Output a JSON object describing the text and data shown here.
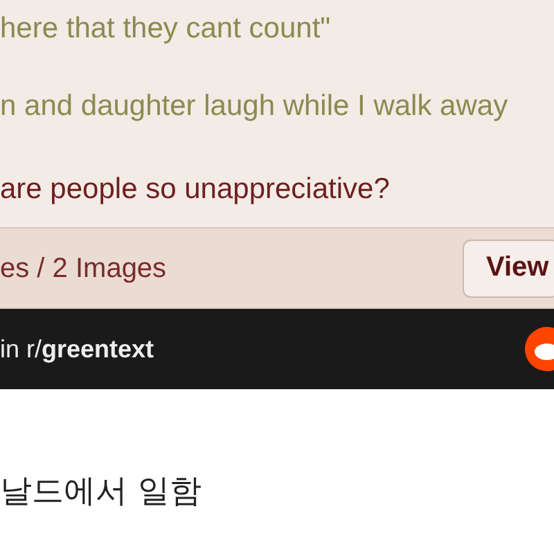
{
  "post": {
    "lines": [
      {
        "kind": "quote",
        "text": "here that they cant count\""
      },
      {
        "kind": "quote",
        "text": "n and daughter laugh while I walk away"
      },
      {
        "kind": "plain",
        "text": "are people so unappreciative?"
      }
    ]
  },
  "footer": {
    "summary": "es / 2 Images",
    "button": "View"
  },
  "share_bar": {
    "text": "in r/**greentext**"
  },
  "article": {
    "text": "날드에서 일함"
  }
}
